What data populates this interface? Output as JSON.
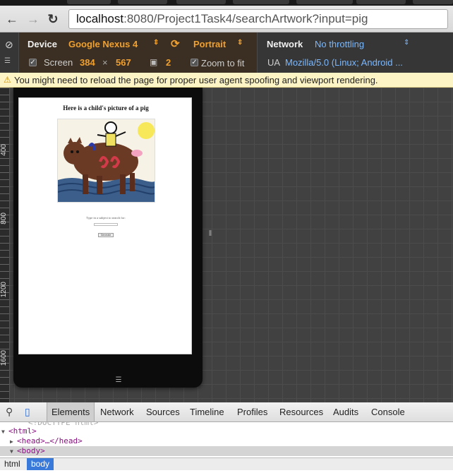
{
  "browser": {
    "url_host": "localhost",
    "url_rest": ":8080/Project1Task4/searchArtwork?input=pig"
  },
  "emulation": {
    "device_label": "Device",
    "device_value": "Google Nexus 4",
    "orientation": "Portrait",
    "screen_label": "Screen",
    "width": "384",
    "times": "×",
    "height": "567",
    "dpr": "2",
    "zoom_label": "Zoom to fit",
    "network_label": "Network",
    "network_value": "No throttling",
    "ua_label": "UA",
    "ua_value": "Mozilla/5.0 (Linux; Android ..."
  },
  "warning": {
    "text": "You might need to reload the page for proper user agent spoofing and viewport rendering."
  },
  "ruler": {
    "marks": [
      "400",
      "800",
      "1200",
      "1600"
    ]
  },
  "page": {
    "heading": "Here is a child's picture of a pig",
    "prompt": "Type in a subject to search for:",
    "button": "Generate"
  },
  "devtools": {
    "tabs": [
      "Elements",
      "Network",
      "Sources",
      "Timeline",
      "Profiles",
      "Resources",
      "Audits",
      "Console"
    ],
    "active_tab": "Elements",
    "tree": {
      "doctype": "<!DOCTYPE html>",
      "html": "<html>",
      "head": "<head>…</head>",
      "body": "<body>"
    },
    "crumbs": [
      "html",
      "body"
    ]
  },
  "colors": {
    "accent_orange": "#f0a030",
    "accent_blue": "#7ab8ff",
    "crumb_active": "#3879d9",
    "warning_bg": "#fcf4c4"
  }
}
